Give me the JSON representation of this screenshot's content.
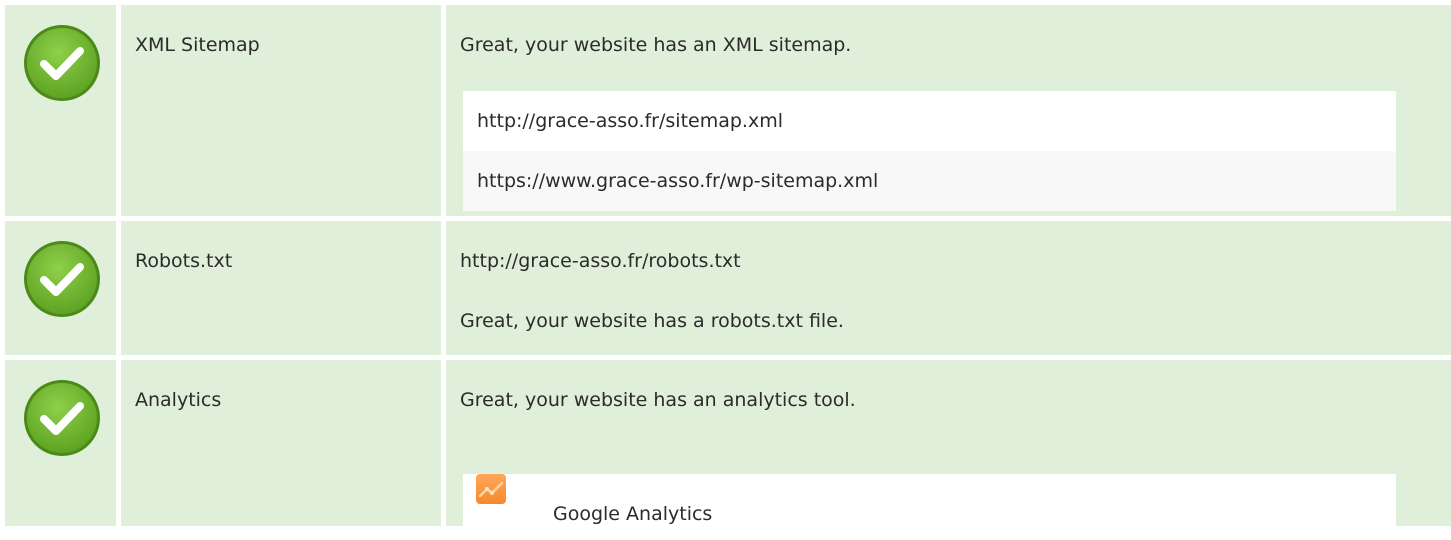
{
  "rows": [
    {
      "label": "XML Sitemap",
      "status_icon": "check-circle-icon",
      "message": "Great, your website has an XML sitemap.",
      "urls": [
        "http://grace-asso.fr/sitemap.xml",
        "https://www.grace-asso.fr/wp-sitemap.xml"
      ]
    },
    {
      "label": "Robots.txt",
      "status_icon": "check-circle-icon",
      "url": "http://grace-asso.fr/robots.txt",
      "message": "Great, your website has a robots.txt file."
    },
    {
      "label": "Analytics",
      "status_icon": "check-circle-icon",
      "message": "Great, your website has an analytics tool.",
      "tools": [
        {
          "name": "Google Analytics",
          "icon": "google-analytics-icon"
        }
      ]
    }
  ],
  "colors": {
    "row_background": "#e0efda",
    "check_green": "#7cbc3a",
    "url_row_alt": "#f8f8f8",
    "analytics_orange": "#f48a2e"
  }
}
